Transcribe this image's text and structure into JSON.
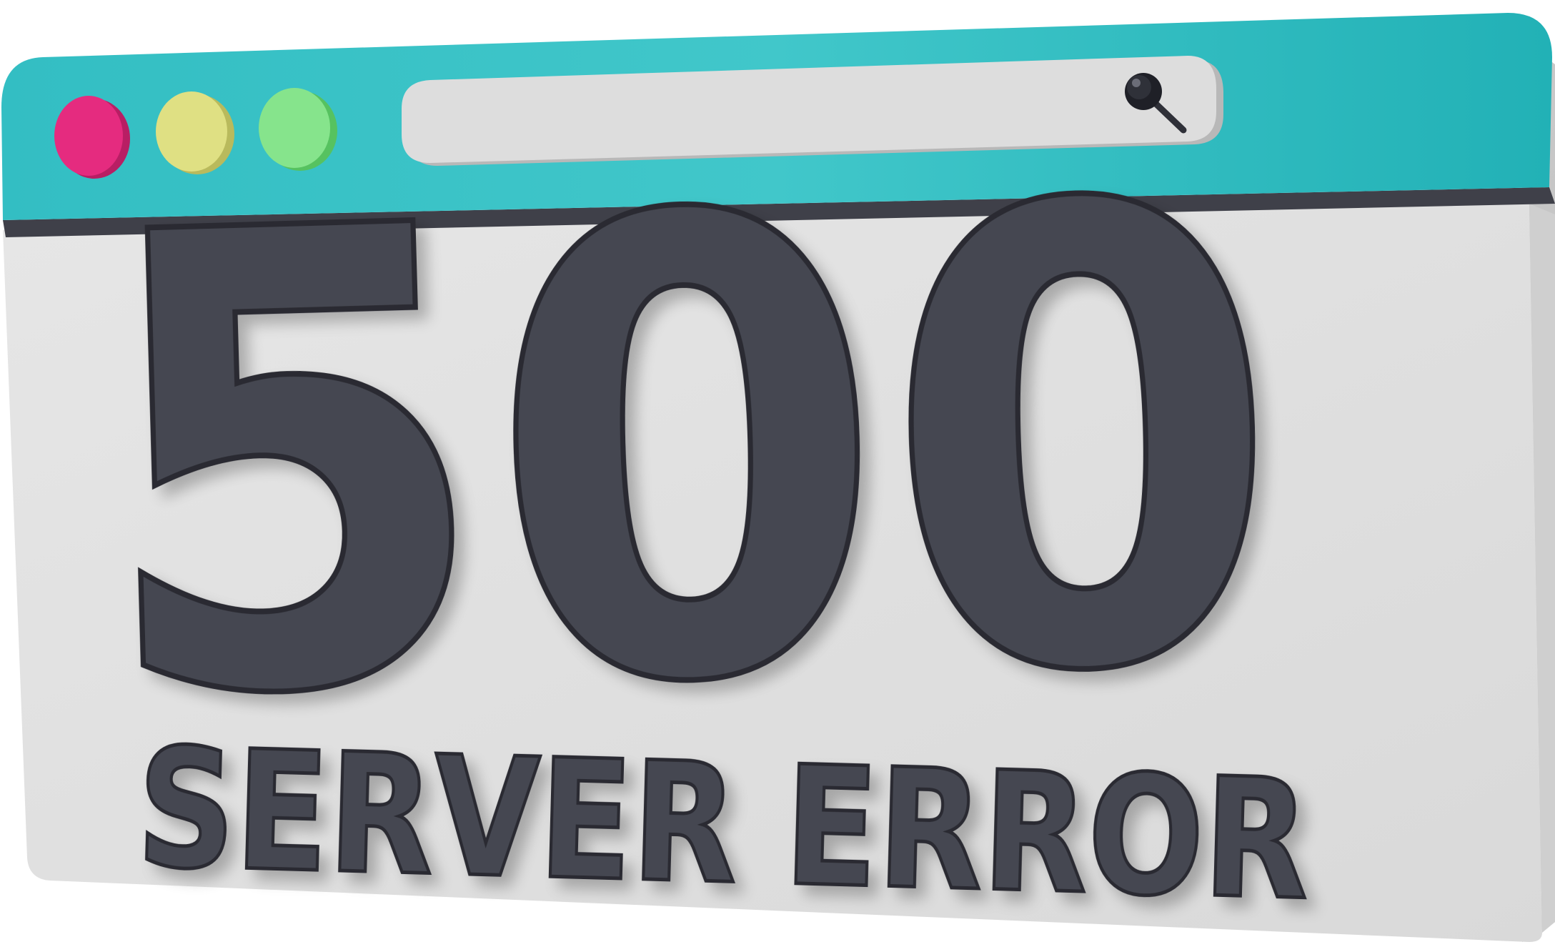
{
  "window": {
    "controls": [
      {
        "name": "close",
        "color": "#e52b7f"
      },
      {
        "name": "minimize",
        "color": "#dfe083"
      },
      {
        "name": "maximize",
        "color": "#86e48c"
      }
    ],
    "titlebar_color": "#3ec3c6",
    "body_color": "#e1e1e1"
  },
  "search": {
    "placeholder": "",
    "icon": "search-icon"
  },
  "error": {
    "code": "500",
    "message": "SERVER ERROR",
    "text_color": "#454751"
  }
}
